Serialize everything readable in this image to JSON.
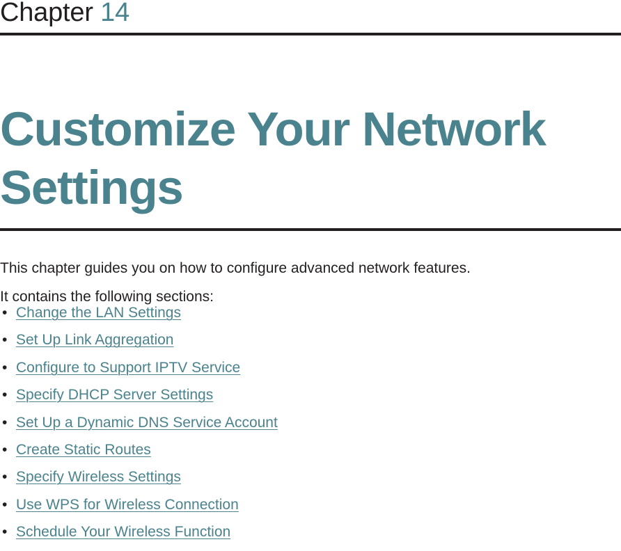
{
  "document": {
    "eyebrow": {
      "label": "Chapter",
      "number": "14"
    },
    "title": "Customize Your Network Settings",
    "intro": {
      "line1": "This chapter guides you on how to configure advanced network features.",
      "line2": "It contains the following sections:"
    },
    "bullet_glyph": "•",
    "sections": [
      {
        "label": "Change the LAN Settings"
      },
      {
        "label": "Set Up Link Aggregation"
      },
      {
        "label": "Configure to Support IPTV Service"
      },
      {
        "label": "Specify DHCP Server Settings"
      },
      {
        "label": "Set Up a Dynamic DNS Service Account"
      },
      {
        "label": "Create Static Routes"
      },
      {
        "label": "Specify Wireless Settings"
      },
      {
        "label": "Use WPS for Wireless Connection"
      },
      {
        "label": "Schedule Your Wireless Function"
      }
    ]
  },
  "colors": {
    "accent_teal": "#4a838d",
    "text_dark": "#231f20",
    "rule": "#231f20",
    "background": "#ffffff"
  }
}
